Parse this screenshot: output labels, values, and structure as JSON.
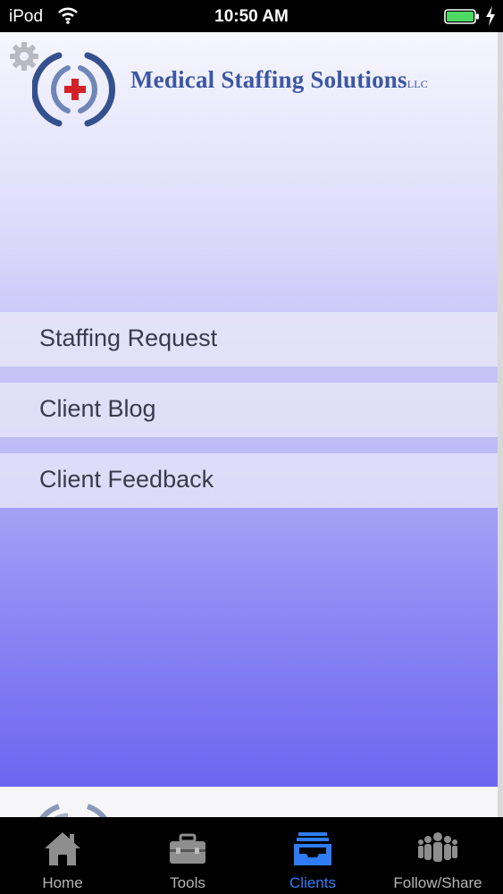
{
  "status_bar": {
    "carrier": "iPod",
    "time": "10:50 AM"
  },
  "header": {
    "brand": "Medical Staffing Solutions",
    "brand_suffix": "LLC"
  },
  "menu": {
    "items": [
      {
        "label": "Staffing Request"
      },
      {
        "label": "Client Blog"
      },
      {
        "label": "Client Feedback"
      }
    ]
  },
  "tab_bar": {
    "tabs": [
      {
        "label": "Home",
        "icon": "home-icon"
      },
      {
        "label": "Tools",
        "icon": "toolbox-icon"
      },
      {
        "label": "Clients",
        "icon": "inbox-tray-icon",
        "active": true
      },
      {
        "label": "Follow/Share",
        "icon": "people-group-icon"
      }
    ]
  },
  "colors": {
    "brand_blue": "#3b57a3",
    "logo_red": "#d42027",
    "active_tab": "#2f7cf6",
    "inactive_tab": "#b4b4b4",
    "battery": "#4cd964"
  }
}
